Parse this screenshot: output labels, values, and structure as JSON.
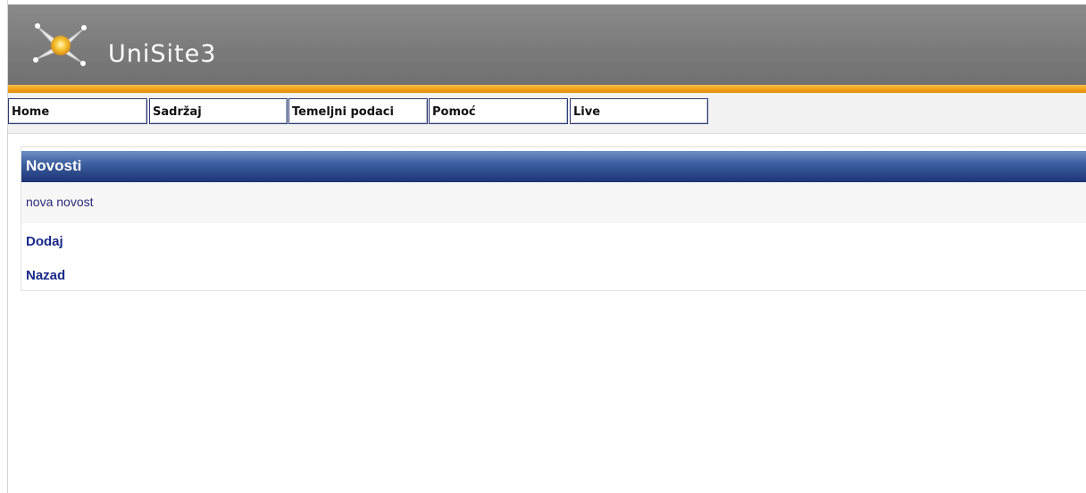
{
  "header": {
    "logo_text": "UniSite3",
    "logo_icon": "uni-star-icon"
  },
  "menu": {
    "items": [
      {
        "label": "Home"
      },
      {
        "label": "Sadržaj"
      },
      {
        "label": "Temeljni podaci"
      },
      {
        "label": "Pomoć"
      },
      {
        "label": "Live"
      }
    ]
  },
  "panel": {
    "title": "Novosti",
    "news_items": [
      {
        "label": "nova novost"
      }
    ],
    "actions": {
      "add_label": "Dodaj",
      "back_label": "Nazad"
    }
  },
  "colors": {
    "header_gray": "#7b7b7b",
    "accent_orange": "#f3a51a",
    "panel_title_blue": "#2b4789",
    "link_blue": "#1a2a8a"
  }
}
